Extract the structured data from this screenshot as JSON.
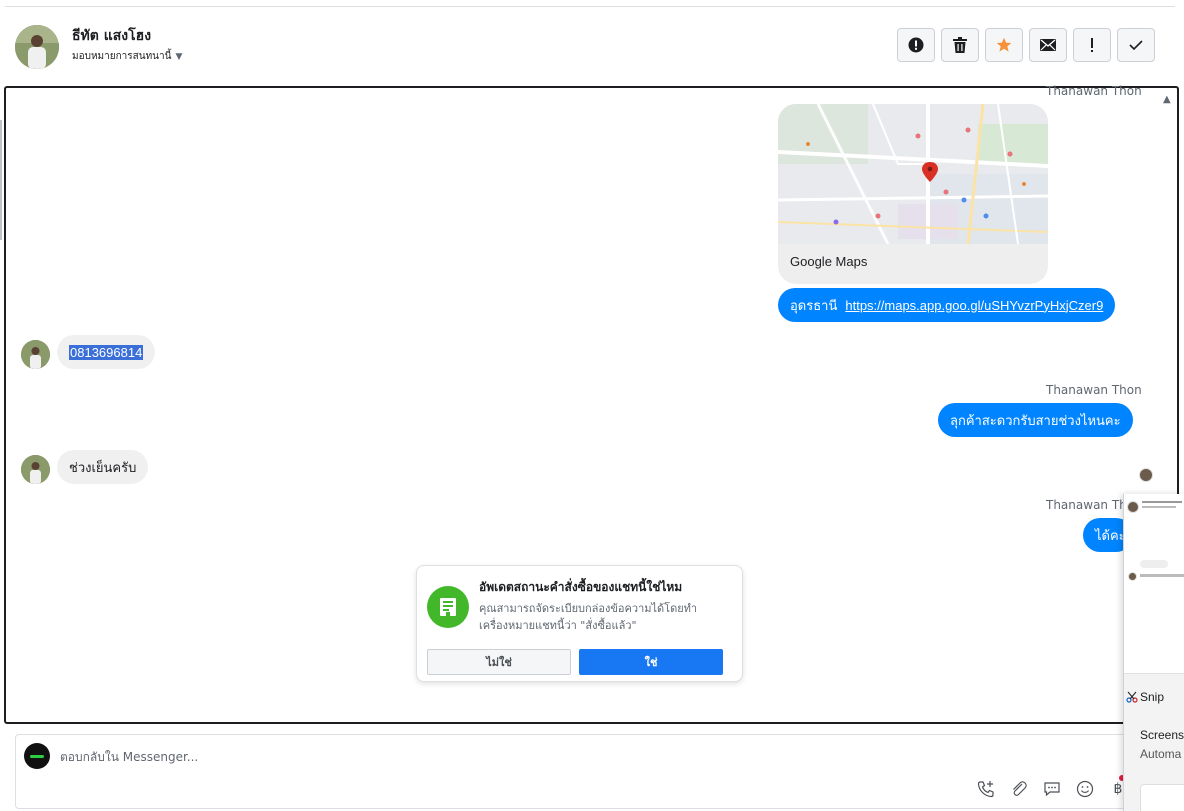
{
  "header": {
    "contact_name": "ธีทัต แสงโฮง",
    "assign_label": "มอบหมายการสนทนานี้",
    "actions": [
      {
        "name": "report-spam",
        "icon": "alert-circle-icon"
      },
      {
        "name": "delete",
        "icon": "trash-icon"
      },
      {
        "name": "star",
        "icon": "star-icon"
      },
      {
        "name": "mark-unread",
        "icon": "envelope-icon"
      },
      {
        "name": "important",
        "icon": "exclamation-icon"
      },
      {
        "name": "mark-done",
        "icon": "check-icon"
      }
    ],
    "star_color": "#f7923b"
  },
  "conversation": {
    "sender_name": "Thanawan Thon",
    "sender_name_cut": "Thanawan Tho",
    "map_card": {
      "label": "Google Maps"
    },
    "messages": [
      {
        "direction": "out",
        "text": "อุดรธานี",
        "link": "https://maps.app.goo.gl/uSHYvzrPyHxjCzer9"
      },
      {
        "direction": "in",
        "text": "0813696814",
        "selected": true
      },
      {
        "direction": "out",
        "text": "ลุกค้าสะดวกรับสายช่วงไหนคะ"
      },
      {
        "direction": "in",
        "text": "ช่วงเย็นครับ"
      },
      {
        "direction": "out",
        "text": "ได้คะ"
      }
    ],
    "bubble_color": "#0084ff"
  },
  "prompt": {
    "title": "อัพเดตสถานะคำสั่งซื้อของแชทนี้ใช่ไหม",
    "body": "คุณสามารถจัดระเบียบกล่องข้อความได้โดยทำเครื่องหมายแชทนี้ว่า \"สั่งซื้อแล้ว\"",
    "no_label": "ไม่ใช่",
    "yes_label": "ใช่"
  },
  "composer": {
    "placeholder": "ตอบกลับใน Messenger...",
    "tools": [
      "phone-plus-icon",
      "paperclip-icon",
      "saved-reply-icon",
      "emoji-icon",
      "baht-icon"
    ]
  },
  "snip_panel": {
    "app_name": "Snip",
    "line1": "Screens",
    "line2": "Automa"
  }
}
